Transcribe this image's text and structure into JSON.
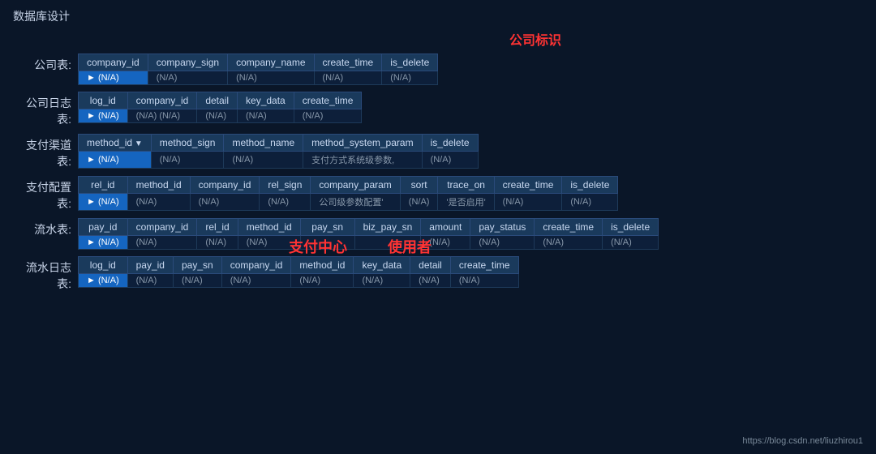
{
  "page": {
    "title": "数据库设计",
    "center_label": "公司标识",
    "footer_link": "https://blog.csdn.net/liuzhirou1"
  },
  "tables": [
    {
      "label": "公司表:",
      "columns": [
        "company_id",
        "company_sign",
        "company_name",
        "create_time",
        "is_delete"
      ],
      "row": [
        "(N/A)",
        "(N/A)",
        "(N/A)",
        "(N/A)",
        "(N/A)"
      ],
      "highlight_col": 0
    },
    {
      "label": "公司日志表:",
      "columns": [
        "log_id",
        "company_id",
        "detail",
        "key_data",
        "create_time"
      ],
      "row": [
        "(N/A)",
        "(N/A) (N/A)",
        "(N/A)",
        "(N/A)",
        ""
      ],
      "highlight_col": 0,
      "row_multi": [
        [
          "(N/A)"
        ],
        [
          "(N/A)",
          "(N/A)"
        ],
        [
          "(N/A)"
        ],
        [
          "(N/A)"
        ],
        [
          ""
        ]
      ]
    },
    {
      "label": "支付渠道表:",
      "columns": [
        "method_id",
        "method_sign",
        "method_name",
        "method_system_param",
        "is_delete"
      ],
      "arrow_col": 0,
      "row": [
        "(N/A)",
        "(N/A)",
        "(N/A)",
        "支付方式系统级参数,",
        "(N/A)"
      ],
      "highlight_col": 0,
      "red_col": 3
    },
    {
      "label": "支付配置表:",
      "columns": [
        "rel_id",
        "method_id",
        "company_id",
        "rel_sign",
        "company_param",
        "sort",
        "trace_on",
        "create_time",
        "is_delete"
      ],
      "row": [
        "(N/A)",
        "(N/A)",
        "(N/A)",
        "(N/A)",
        "公司级参数配置'",
        "(N/A)",
        "'是否启用'",
        "(N/A)",
        "(N/A)"
      ],
      "highlight_col": 0,
      "red_cols": [
        4,
        6
      ]
    },
    {
      "label": "流水表:",
      "columns": [
        "pay_id",
        "company_id",
        "rel_id",
        "method_id",
        "pay_sn",
        "biz_pay_sn",
        "amount",
        "pay_status",
        "create_time",
        "is_delete"
      ],
      "row": [
        "(N/A)",
        "(N/A)",
        "(N/A)",
        "(N/A)",
        "",
        "",
        "(N/A)",
        "(N/A)",
        "(N/A)",
        "(N/A)"
      ],
      "highlight_col": 0,
      "overlay": true
    },
    {
      "label": "流水日志表:",
      "columns": [
        "log_id",
        "pay_id",
        "pay_sn",
        "company_id",
        "method_id",
        "key_data",
        "detail",
        "create_time"
      ],
      "row": [
        "(N/A)",
        "(N/A)",
        "(N/A)",
        "(N/A)",
        "(N/A)",
        "(N/A)",
        "(N/A)",
        "(N/A)"
      ],
      "highlight_col": 0
    }
  ]
}
